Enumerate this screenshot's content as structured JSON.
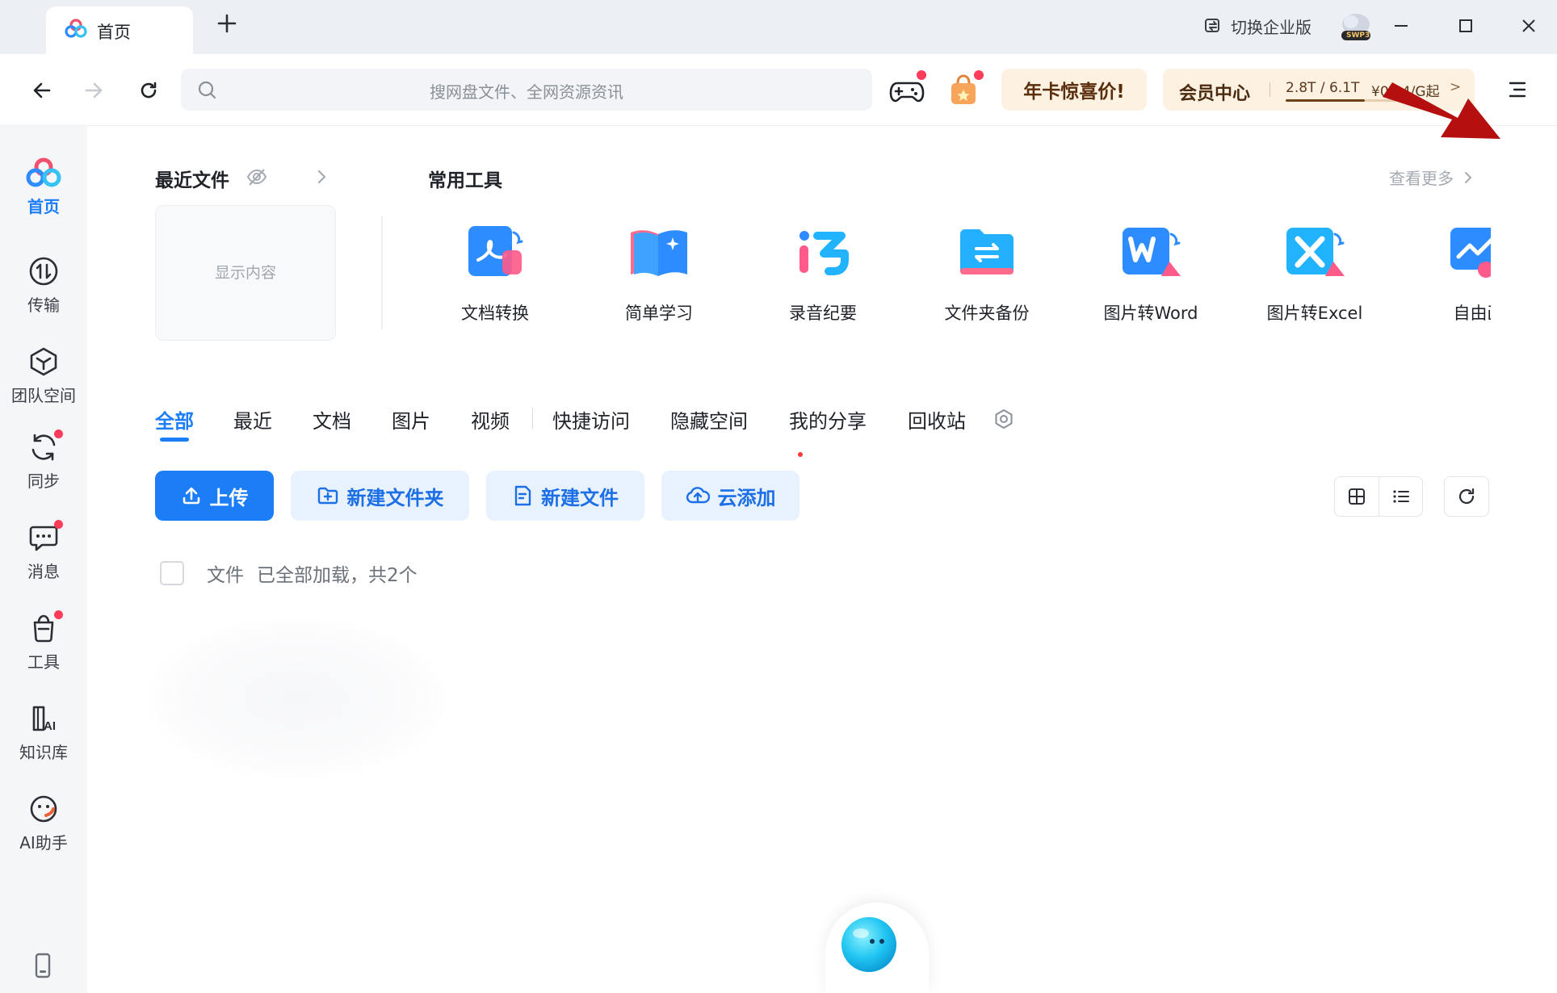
{
  "titlebar": {
    "tab_title": "首页",
    "switch_enterprise": "切换企业版",
    "svip_badge": "SWP3"
  },
  "toolbar": {
    "search_placeholder": "搜网盘文件、全网资源资讯",
    "promo_label": "年卡惊喜价!",
    "member_title": "会员中心",
    "storage": "2.8T / 6.1T",
    "storage_used_fraction": 0.459,
    "price": "¥0.04/G起",
    "price_chevron": ">"
  },
  "sidebar": {
    "items": [
      {
        "label": "首页",
        "icon": "cloud-logo-icon",
        "active": true,
        "dot": false
      },
      {
        "label": "传输",
        "icon": "transfer-icon",
        "active": false,
        "dot": false
      },
      {
        "label": "团队空间",
        "icon": "team-space-icon",
        "active": false,
        "dot": false
      },
      {
        "label": "同步",
        "icon": "sync-icon",
        "active": false,
        "dot": true
      },
      {
        "label": "消息",
        "icon": "message-icon",
        "active": false,
        "dot": true
      },
      {
        "label": "工具",
        "icon": "tools-icon",
        "active": false,
        "dot": true
      },
      {
        "label": "知识库",
        "icon": "knowledge-base-icon",
        "active": false,
        "dot": false
      },
      {
        "label": "AI助手",
        "icon": "ai-assistant-icon",
        "active": false,
        "dot": false
      }
    ]
  },
  "recent": {
    "title": "最近文件",
    "placeholder": "显示内容"
  },
  "tools": {
    "title": "常用工具",
    "more": "查看更多",
    "items": [
      {
        "label": "文档转换",
        "icon": "doc-convert-icon"
      },
      {
        "label": "简单学习",
        "icon": "simple-study-icon"
      },
      {
        "label": "录音纪要",
        "icon": "recording-notes-icon"
      },
      {
        "label": "文件夹备份",
        "icon": "folder-backup-icon"
      },
      {
        "label": "图片转Word",
        "icon": "image-to-word-icon"
      },
      {
        "label": "图片转Excel",
        "icon": "image-to-excel-icon"
      },
      {
        "label": "自由画",
        "icon": "free-draw-icon"
      }
    ]
  },
  "file_tabs": [
    "全部",
    "最近",
    "文档",
    "图片",
    "视频",
    "快捷访问",
    "隐藏空间",
    "我的分享",
    "回收站"
  ],
  "actions": {
    "upload": "上传",
    "new_folder": "新建文件夹",
    "new_file": "新建文件",
    "cloud_add": "云添加"
  },
  "file_list": {
    "header": "文件",
    "status": "已全部加载，共2个"
  },
  "colors": {
    "accent": "#1c7ef6",
    "promo_bg": "#fdf1e1",
    "badge": "#ff3b5c",
    "annotation": "#b50f0f"
  }
}
